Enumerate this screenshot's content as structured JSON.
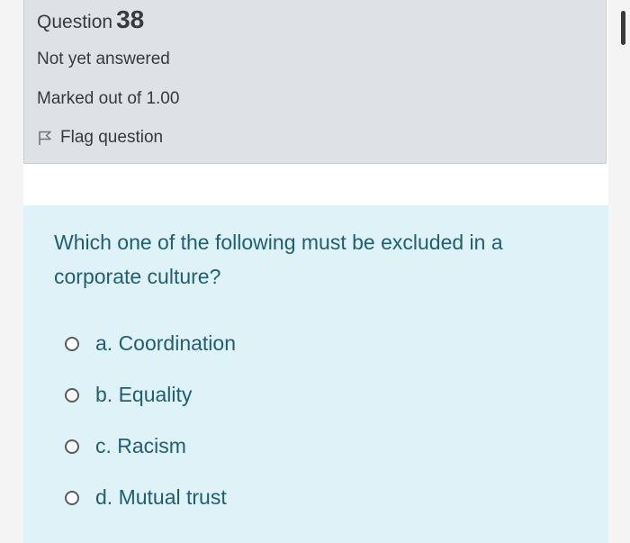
{
  "question": {
    "title_prefix": "Question",
    "number": "38",
    "state": "Not yet answered",
    "grade": "Marked out of 1.00",
    "flag_label": "Flag question"
  },
  "formulation": {
    "text": "Which one of the following must be excluded in a corporate culture?",
    "options": [
      {
        "label": "a. Coordination"
      },
      {
        "label": "b. Equality"
      },
      {
        "label": "c. Racism"
      },
      {
        "label": "d. Mutual trust"
      }
    ]
  },
  "icons": {
    "flag": "flag-outline-icon",
    "radio": "radio-unchecked-icon"
  },
  "colors": {
    "info_bg": "#dee2e6",
    "formulation_bg": "#def2f8",
    "question_text": "#1f5f73",
    "info_text": "#343a40"
  }
}
